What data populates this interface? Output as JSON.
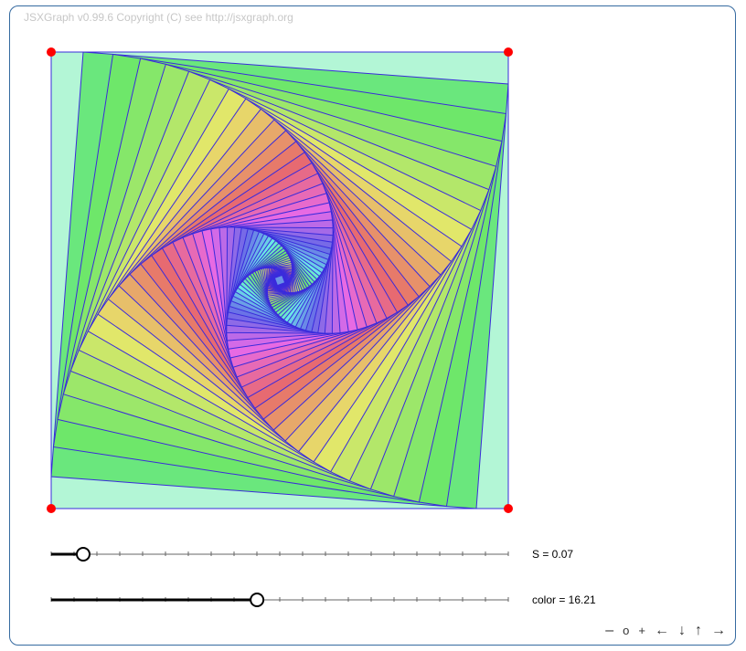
{
  "board": {
    "copyright": "JSXGraph v0.99.6 Copyright (C) see http://jsxgraph.org"
  },
  "sliders": [
    {
      "name": "S",
      "value": 0.07,
      "min": 0,
      "max": 1,
      "label": "S = 0.07"
    },
    {
      "name": "color",
      "value": 16.21,
      "min": 0,
      "max": 36,
      "label": "color = 16.21"
    }
  ],
  "navigation": {
    "zoom_out": "–",
    "zoom_reset": "o",
    "zoom_in": "+",
    "left": "←",
    "down": "↓",
    "up": "↑",
    "right": "→"
  },
  "colors": {
    "border": "#356aa0",
    "edge": "#3a2bdb",
    "point": "#ff0000",
    "outer_fill": "#b3f6d6"
  }
}
